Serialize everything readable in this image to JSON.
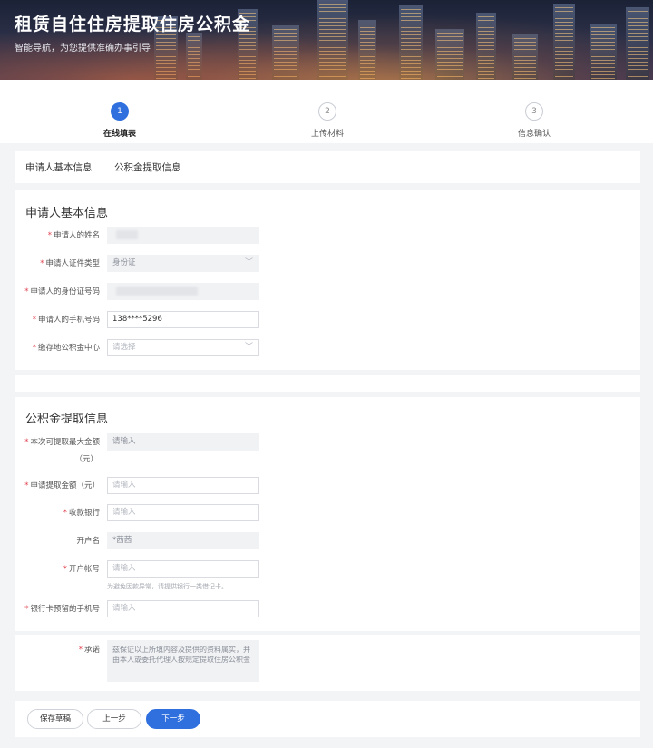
{
  "banner": {
    "title": "租赁自住住房提取住房公积金",
    "subtitle": "智能导航，为您提供准确办事引导"
  },
  "steps": [
    {
      "number": "1",
      "label": "在线填表",
      "active": true
    },
    {
      "number": "2",
      "label": "上传材料",
      "active": false
    },
    {
      "number": "3",
      "label": "信息确认",
      "active": false
    }
  ],
  "tabs": [
    "申请人基本信息",
    "公积金提取信息"
  ],
  "applicant": {
    "title": "申请人基本信息",
    "fields": [
      {
        "label": "申请人的姓名",
        "value": ""
      },
      {
        "label": "申请人证件类型",
        "value": "身份证"
      },
      {
        "label": "申请人的身份证号码",
        "value": ""
      },
      {
        "label": "申请人的手机号码",
        "value": "138****5296"
      },
      {
        "label": "缴存地公积金中心",
        "placeholder": "请选择"
      }
    ]
  },
  "withdrawal": {
    "title": "公积金提取信息",
    "max_amount": {
      "label": "本次可提取最大金额",
      "unit": "（元）",
      "placeholder": "请输入"
    },
    "amount": {
      "label": "申请提取金额（元）",
      "placeholder": "请输入"
    },
    "bank": {
      "label": "收款银行",
      "placeholder": "请输入"
    },
    "account_name": {
      "label": "开户名",
      "value": "*茜茜"
    },
    "account_no": {
      "label": "开户帐号",
      "placeholder": "请输入",
      "hint": "为避免因款异常，请提供银行一类借记卡。"
    },
    "bank_phone": {
      "label": "银行卡预留的手机号",
      "placeholder": "请输入"
    }
  },
  "commitment": {
    "label": "承诺",
    "text": "兹保证以上所填内容及提供的资料属实，并由本人或委托代理人按规定提取住房公积金"
  },
  "buttons": {
    "save_draft": "保存草稿",
    "prev": "上一步",
    "next": "下一步"
  },
  "colors": {
    "primary": "#2f6fde",
    "required": "#e0434f"
  }
}
